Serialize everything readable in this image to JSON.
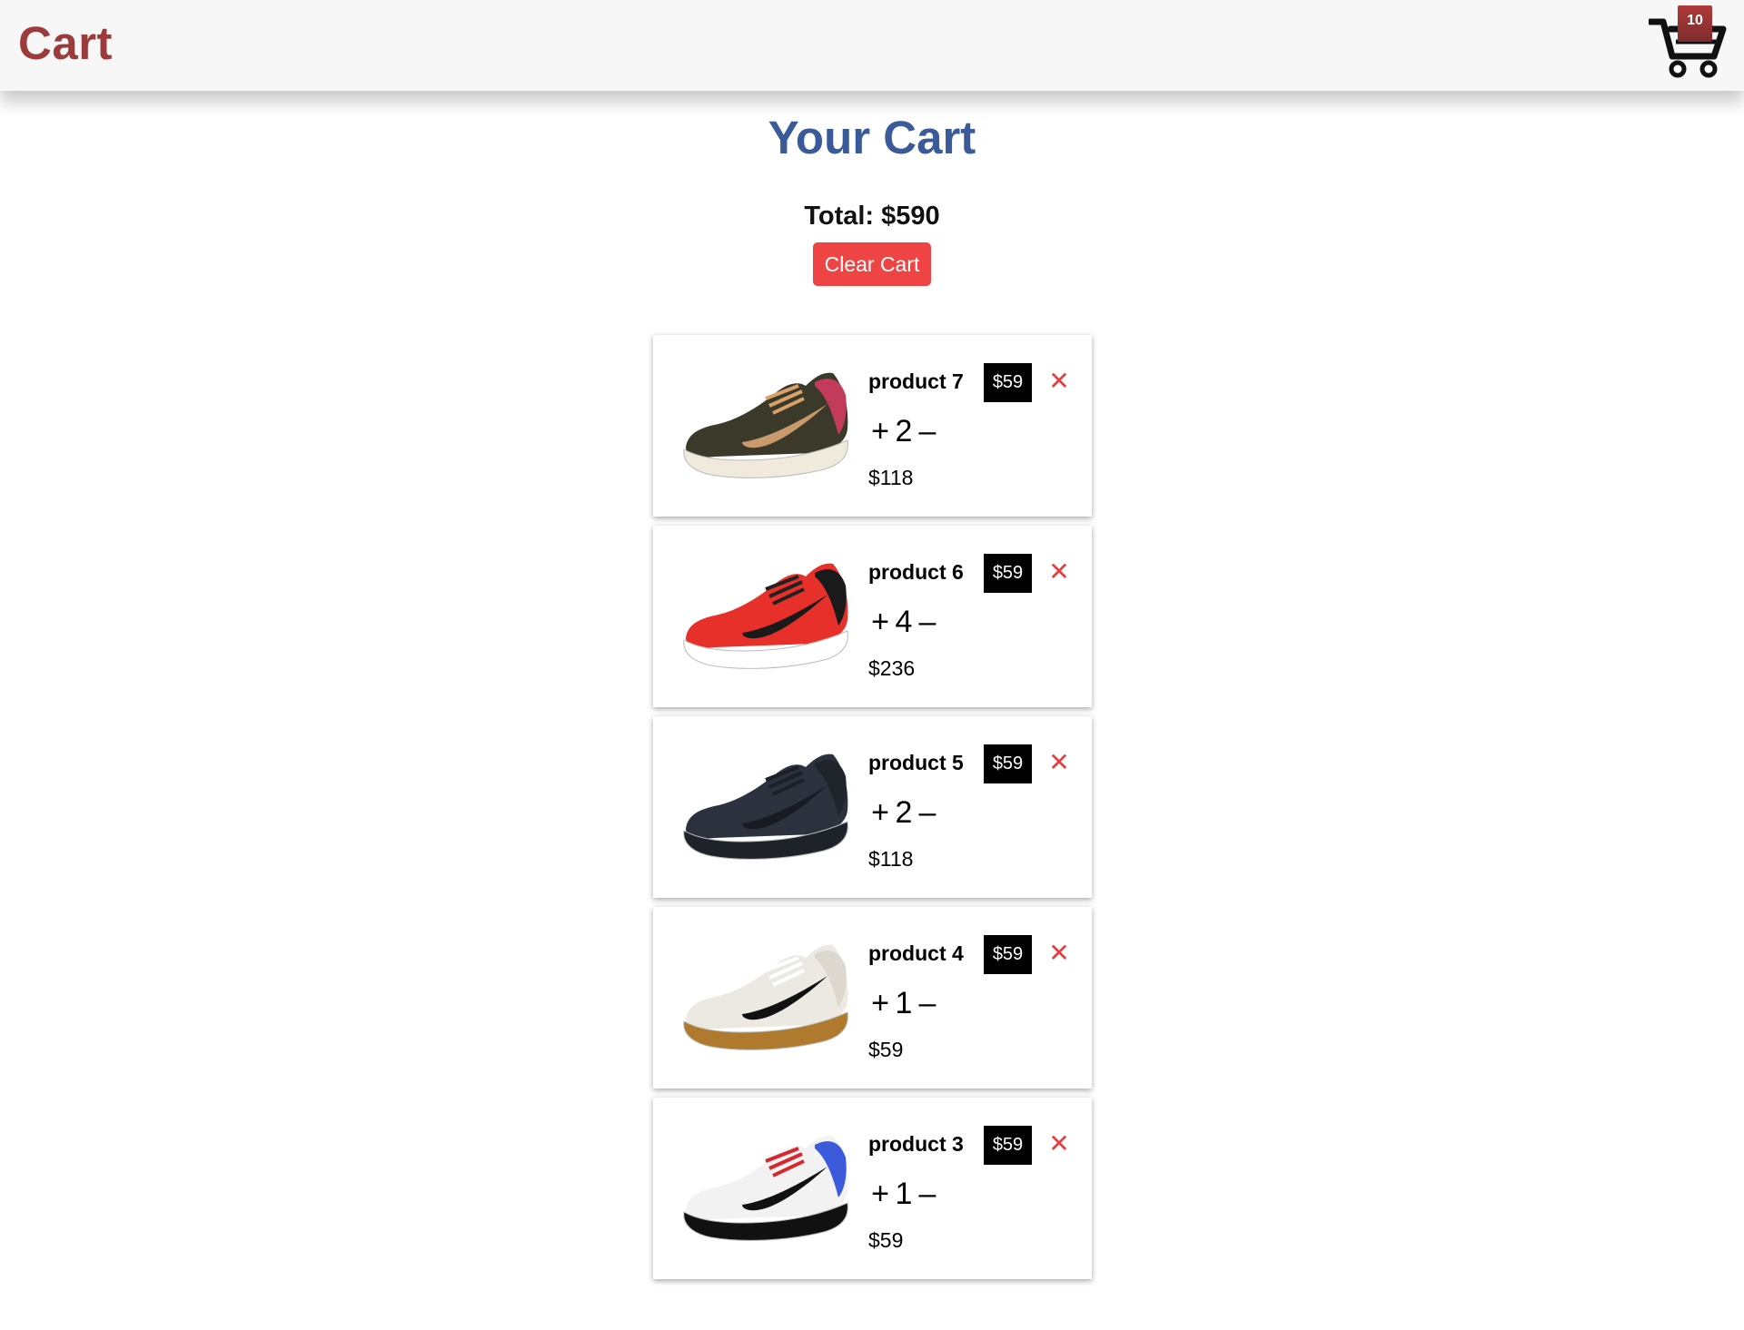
{
  "header": {
    "brand": "Cart",
    "cart_count": "10"
  },
  "page": {
    "title": "Your Cart",
    "total": "Total: $590",
    "clear_label": "Clear Cart"
  },
  "items": [
    {
      "name": "product 7",
      "price": "$59",
      "remove": "✕",
      "plus": "+",
      "qty": "2",
      "minus": "–",
      "subtotal": "$118",
      "shoe": {
        "upper": "#3b3a2a",
        "sole": "#efeadb",
        "accent": "#d8a26a",
        "heel": "#c23b5a",
        "swoosh": "#c99a6b"
      }
    },
    {
      "name": "product 6",
      "price": "$59",
      "remove": "✕",
      "plus": "+",
      "qty": "4",
      "minus": "–",
      "subtotal": "$236",
      "shoe": {
        "upper": "#e8302a",
        "sole": "#ffffff",
        "accent": "#222222",
        "heel": "#1a1a1a",
        "swoosh": "#1a1a1a"
      }
    },
    {
      "name": "product 5",
      "price": "$59",
      "remove": "✕",
      "plus": "+",
      "qty": "2",
      "minus": "–",
      "subtotal": "$118",
      "shoe": {
        "upper": "#2b323d",
        "sole": "#1e232a",
        "accent": "#1b1f26",
        "heel": "#20252c",
        "swoosh": "#181c22"
      }
    },
    {
      "name": "product 4",
      "price": "$59",
      "remove": "✕",
      "plus": "+",
      "qty": "1",
      "minus": "–",
      "subtotal": "$59",
      "shoe": {
        "upper": "#ece9e2",
        "sole": "#b07a2e",
        "accent": "#ffffff",
        "heel": "#dcd8cf",
        "swoosh": "#111111"
      }
    },
    {
      "name": "product 3",
      "price": "$59",
      "remove": "✕",
      "plus": "+",
      "qty": "1",
      "minus": "–",
      "subtotal": "$59",
      "shoe": {
        "upper": "#f2f2f2",
        "sole": "#111111",
        "accent": "#d8262e",
        "heel": "#3b5bdb",
        "swoosh": "#111111"
      }
    }
  ]
}
